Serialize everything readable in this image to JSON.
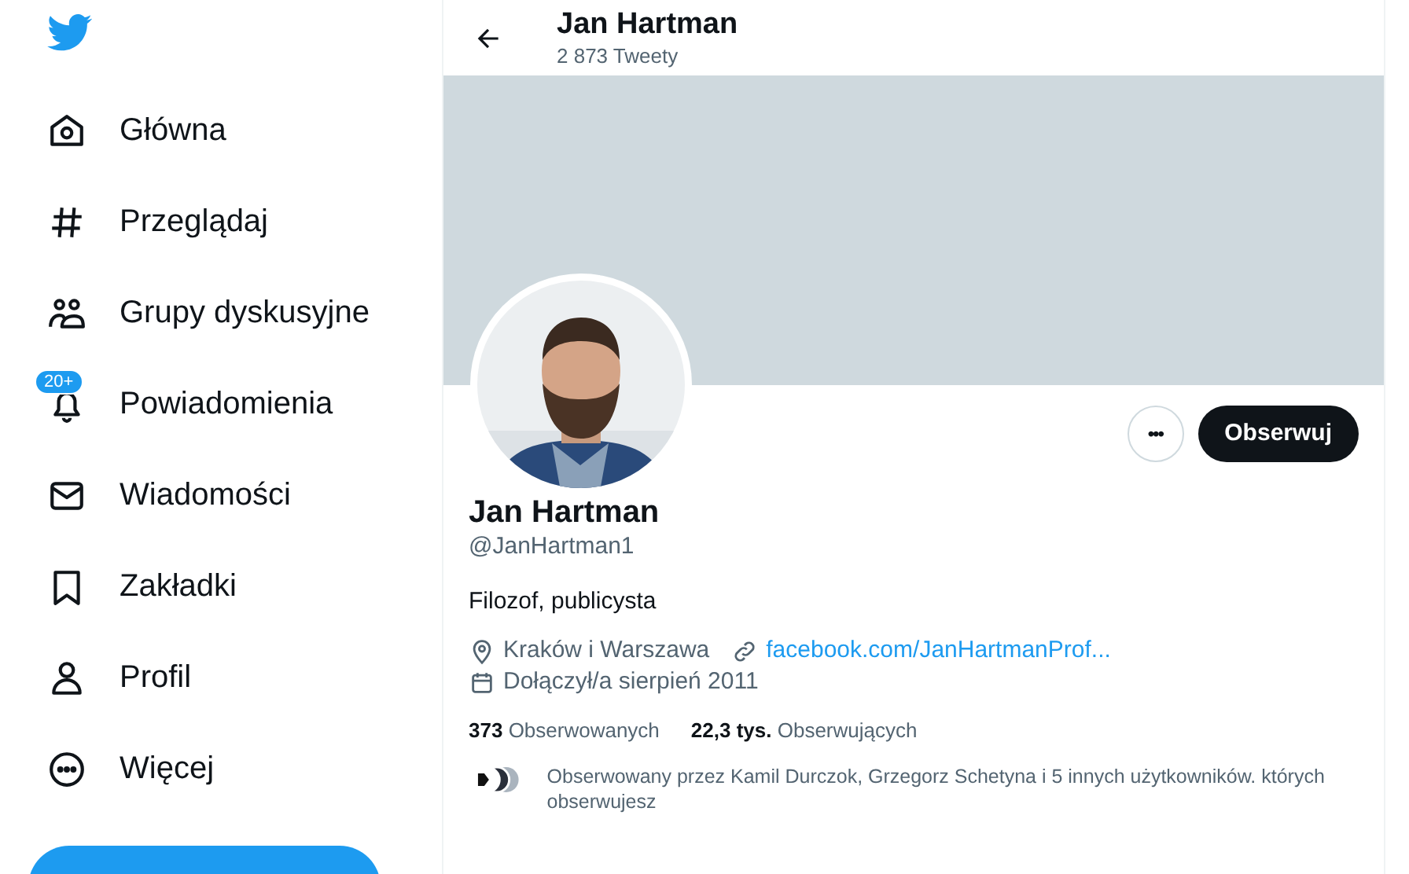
{
  "sidebar": {
    "items": [
      {
        "label": "Główna"
      },
      {
        "label": "Przeglądaj"
      },
      {
        "label": "Grupy dyskusyjne"
      },
      {
        "label": "Powiadomienia",
        "badge": "20+"
      },
      {
        "label": "Wiadomości"
      },
      {
        "label": "Zakładki"
      },
      {
        "label": "Profil"
      },
      {
        "label": "Więcej"
      }
    ]
  },
  "header": {
    "title": "Jan Hartman",
    "subtitle": "2 873 Tweety"
  },
  "profile": {
    "more_button": "•••",
    "follow_button": "Obserwuj",
    "name": "Jan Hartman",
    "handle": "@JanHartman1",
    "bio": "Filozof, publicysta",
    "location": "Kraków i Warszawa",
    "website": "facebook.com/JanHartmanProf...",
    "joined": "Dołączył/a sierpień 2011",
    "stats": [
      {
        "count": "373",
        "label": "Obserwowanych"
      },
      {
        "count": "22,3 tys.",
        "label": "Obserwujących"
      }
    ],
    "followed_by": "Obserwowany przez Kamil Durczok, Grzegorz Schetyna i 5 innych użytkowników. których obserwujesz"
  }
}
